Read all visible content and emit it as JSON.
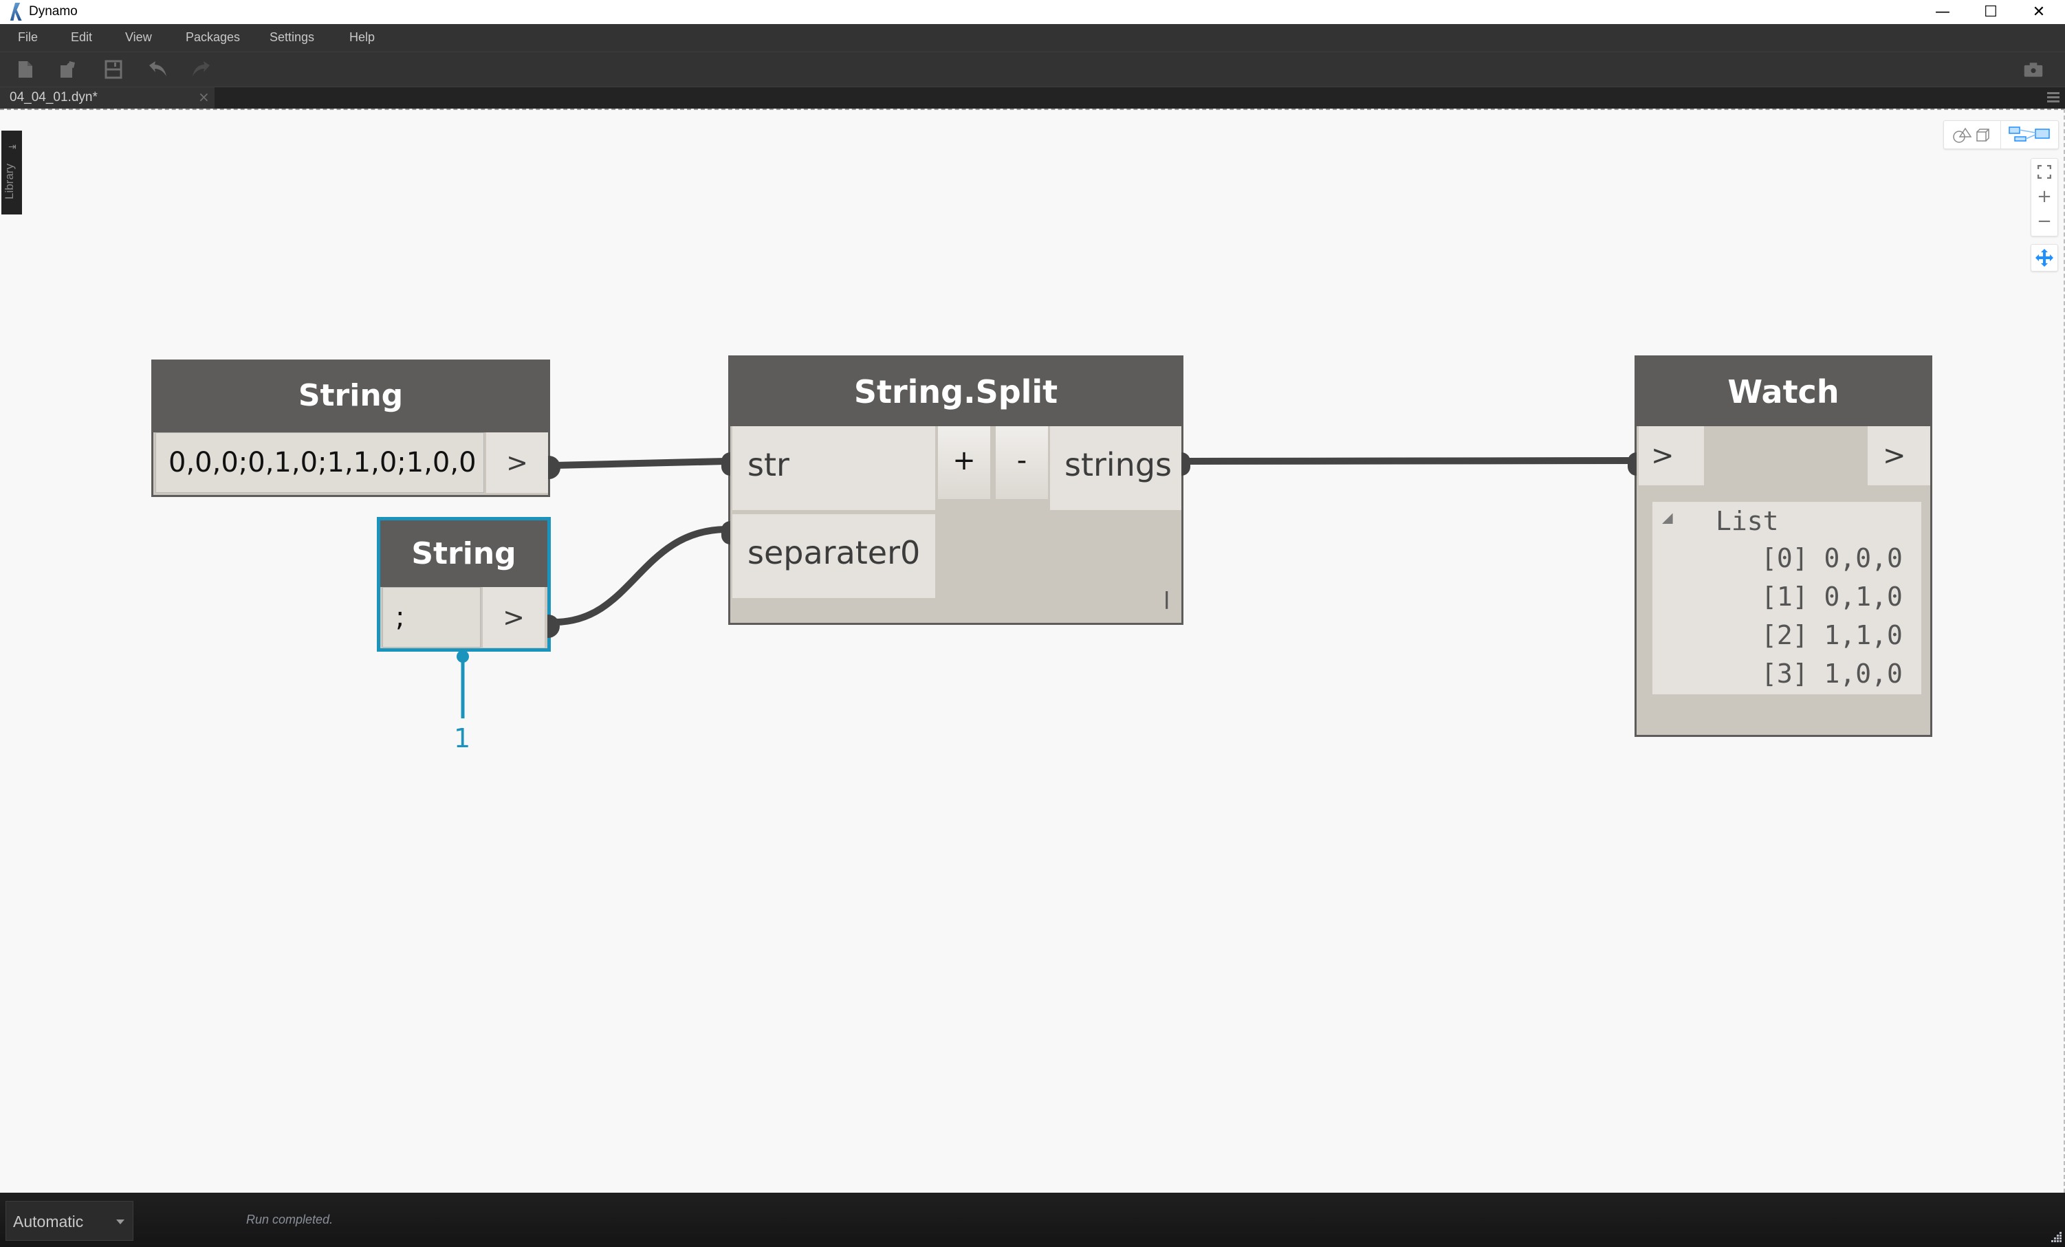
{
  "window": {
    "title": "Dynamo",
    "minimize_glyph": "—",
    "maximize_glyph": "☐",
    "close_glyph": "✕"
  },
  "menu": {
    "items": [
      {
        "label": "File"
      },
      {
        "label": "Edit"
      },
      {
        "label": "View"
      },
      {
        "label": "Packages"
      },
      {
        "label": "Settings"
      },
      {
        "label": "Help"
      }
    ]
  },
  "toolbar": {
    "icons": [
      "new-file-icon",
      "open-file-icon",
      "save-icon",
      "undo-icon",
      "redo-icon",
      "screenshot-camera-icon"
    ]
  },
  "tabs": [
    {
      "label": "04_04_01.dyn*",
      "close_glyph": "×",
      "active": true
    }
  ],
  "library": {
    "label": "Library",
    "arrow_glyph": "⇥"
  },
  "canvas_controls": {
    "zoom_fit_glyph": "⛶",
    "zoom_in_glyph": "+",
    "zoom_out_glyph": "−",
    "pan_glyph": "✥",
    "active_view": "graph-view",
    "accent_color": "#1e90ff"
  },
  "nodes": {
    "string1": {
      "title": "String",
      "value": "0,0,0;0,1,0;1,1,0;1,0,0",
      "output_glyph": ">"
    },
    "string2": {
      "title": "String",
      "value": ";",
      "output_glyph": ">",
      "selected": true,
      "selection_color": "#1a93bd",
      "annotation": "1"
    },
    "split": {
      "title": "String.Split",
      "inputs": [
        "str",
        "separater0"
      ],
      "add_label": "+",
      "remove_label": "-",
      "output": "strings",
      "lacing_marker": "l"
    },
    "watch": {
      "title": "Watch",
      "input_glyph": ">",
      "output_glyph": ">",
      "list_header": "List",
      "collapse_glyph": "◢",
      "items": [
        {
          "index": "[0]",
          "value": "0,0,0"
        },
        {
          "index": "[1]",
          "value": "0,1,0"
        },
        {
          "index": "[2]",
          "value": "1,1,0"
        },
        {
          "index": "[3]",
          "value": "1,0,0"
        }
      ]
    }
  },
  "status": {
    "run_mode": "Automatic",
    "message": "Run completed."
  }
}
